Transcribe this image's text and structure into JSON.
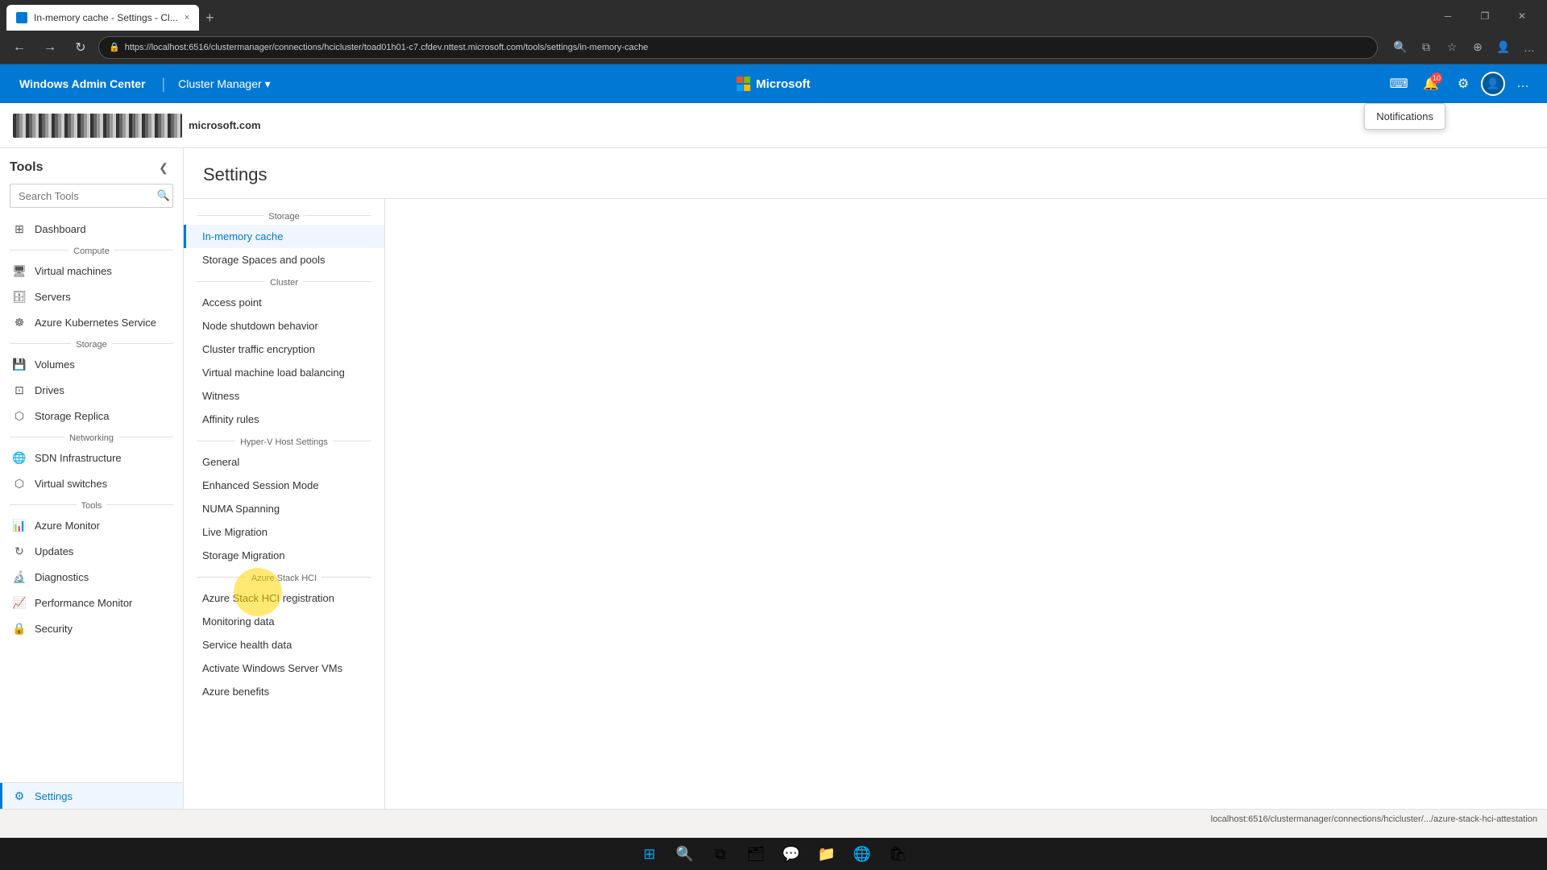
{
  "browser": {
    "tab_title": "In-memory cache - Settings - Cl...",
    "tab_close": "×",
    "new_tab": "+",
    "url": "https://localhost:6516/clustermanager/connections/hcicluster/toad01h01-c7.cfdev.nttest.microsoft.com/tools/settings/in-memory-cache",
    "win_minimize": "─",
    "win_restore": "❐",
    "win_close": "✕",
    "nav_back": "←",
    "nav_forward": "→",
    "nav_refresh": "↻"
  },
  "wac": {
    "brand": "Windows Admin Center",
    "separator": "|",
    "cluster_manager": "Cluster Manager",
    "ms_logo": "Microsoft",
    "notification_count": "10",
    "notifications_label": "Notifications"
  },
  "logo_bar": {
    "logo_text": "microsoft.com"
  },
  "sidebar": {
    "title": "Tools",
    "search_placeholder": "Search Tools",
    "collapse_icon": "❮",
    "sections": {
      "compute_label": "Compute",
      "storage_label": "Storage",
      "networking_label": "Networking",
      "tools_label": "Tools"
    },
    "items": [
      {
        "id": "dashboard",
        "label": "Dashboard",
        "icon": "⊞",
        "section": "none"
      },
      {
        "id": "virtual-machines",
        "label": "Virtual machines",
        "icon": "□",
        "section": "compute"
      },
      {
        "id": "servers",
        "label": "Servers",
        "icon": "▣",
        "section": "compute"
      },
      {
        "id": "azure-kubernetes",
        "label": "Azure Kubernetes Service",
        "icon": "◈",
        "section": "compute"
      },
      {
        "id": "volumes",
        "label": "Volumes",
        "icon": "◧",
        "section": "storage"
      },
      {
        "id": "drives",
        "label": "Drives",
        "icon": "⊡",
        "section": "storage"
      },
      {
        "id": "storage-replica",
        "label": "Storage Replica",
        "icon": "⬡",
        "section": "storage"
      },
      {
        "id": "sdn-infrastructure",
        "label": "SDN Infrastructure",
        "icon": "⬡",
        "section": "networking"
      },
      {
        "id": "virtual-switches",
        "label": "Virtual switches",
        "icon": "⬡",
        "section": "networking"
      },
      {
        "id": "azure-monitor",
        "label": "Azure Monitor",
        "icon": "◫",
        "section": "tools"
      },
      {
        "id": "updates",
        "label": "Updates",
        "icon": "↻",
        "section": "tools"
      },
      {
        "id": "diagnostics",
        "label": "Diagnostics",
        "icon": "◉",
        "section": "tools"
      },
      {
        "id": "performance-monitor",
        "label": "Performance Monitor",
        "icon": "◈",
        "section": "tools"
      },
      {
        "id": "security",
        "label": "Security",
        "icon": "🔒",
        "section": "tools"
      },
      {
        "id": "settings",
        "label": "Settings",
        "icon": "⚙",
        "section": "none",
        "bottom": true
      }
    ]
  },
  "settings": {
    "page_title": "Settings",
    "nav": {
      "storage_section": "Storage",
      "cluster_section": "Cluster",
      "hyperv_section": "Hyper-V Host Settings",
      "azure_stack_section": "Azure Stack HCI",
      "items": [
        {
          "id": "in-memory-cache",
          "label": "In-memory cache",
          "section": "storage",
          "active": true
        },
        {
          "id": "storage-spaces-pools",
          "label": "Storage Spaces and pools",
          "section": "storage"
        },
        {
          "id": "access-point",
          "label": "Access point",
          "section": "cluster"
        },
        {
          "id": "node-shutdown",
          "label": "Node shutdown behavior",
          "section": "cluster"
        },
        {
          "id": "cluster-traffic-encryption",
          "label": "Cluster traffic encryption",
          "section": "cluster"
        },
        {
          "id": "vm-load-balancing",
          "label": "Virtual machine load balancing",
          "section": "cluster"
        },
        {
          "id": "witness",
          "label": "Witness",
          "section": "cluster"
        },
        {
          "id": "affinity-rules",
          "label": "Affinity rules",
          "section": "cluster"
        },
        {
          "id": "general",
          "label": "General",
          "section": "hyperv"
        },
        {
          "id": "enhanced-session-mode",
          "label": "Enhanced Session Mode",
          "section": "hyperv"
        },
        {
          "id": "numa-spanning",
          "label": "NUMA Spanning",
          "section": "hyperv"
        },
        {
          "id": "live-migration",
          "label": "Live Migration",
          "section": "hyperv"
        },
        {
          "id": "storage-migration",
          "label": "Storage Migration",
          "section": "hyperv"
        },
        {
          "id": "azure-stack-hci-registration",
          "label": "Azure Stack HCI registration",
          "section": "azure_stack"
        },
        {
          "id": "monitoring-data",
          "label": "Monitoring data",
          "section": "azure_stack"
        },
        {
          "id": "service-health-data",
          "label": "Service health data",
          "section": "azure_stack"
        },
        {
          "id": "activate-windows-server-vms",
          "label": "Activate Windows Server VMs",
          "section": "azure_stack"
        },
        {
          "id": "azure-benefits",
          "label": "Azure benefits",
          "section": "azure_stack"
        }
      ]
    }
  },
  "taskbar": {
    "items": [
      {
        "id": "start",
        "icon": "⊞",
        "label": "Start"
      },
      {
        "id": "search",
        "icon": "🔍",
        "label": "Search"
      },
      {
        "id": "task-view",
        "icon": "⧉",
        "label": "Task View"
      },
      {
        "id": "widgets",
        "icon": "⊡",
        "label": "Widgets"
      },
      {
        "id": "teams",
        "icon": "⬡",
        "label": "Teams"
      },
      {
        "id": "file-explorer",
        "icon": "📁",
        "label": "File Explorer"
      },
      {
        "id": "edge",
        "icon": "◈",
        "label": "Edge"
      },
      {
        "id": "store",
        "icon": "🛍",
        "label": "Store"
      }
    ]
  },
  "status_bar": {
    "url": "localhost:6516/clustermanager/connections/hcicluster/.../azure-stack-hci-attestation"
  }
}
